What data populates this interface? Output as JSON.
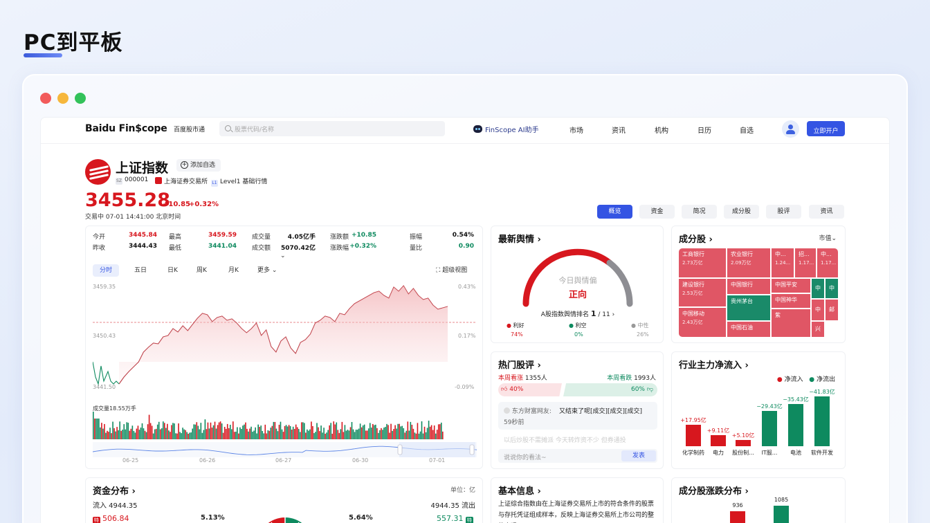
{
  "slide": {
    "title": "PC到平板"
  },
  "nav": {
    "logo": "Baidu Fin$cope",
    "sub": "百度股市通",
    "search_placeholder": "股票代码/名称",
    "ai": "FinScope AI助手",
    "items": [
      "市场",
      "资讯",
      "机构",
      "日历",
      "自选"
    ],
    "open_account": "立即开户"
  },
  "stock": {
    "name": "上证指数",
    "add_fav": "添加自选",
    "market_tag": "SZ",
    "code": "000001",
    "exchange": "上海证券交易所",
    "level_tag": "L1",
    "level": "Level1 基础行情",
    "price": "3455.28",
    "change": "+10.85",
    "change_pct": "+0.32%",
    "trade_time": "交易中  07-01 14:41:00 北京时间"
  },
  "tabs": [
    "概览",
    "资金",
    "简况",
    "成分股",
    "股评",
    "资讯"
  ],
  "quote": {
    "rows": [
      [
        {
          "k": "今开",
          "v": "3445.84",
          "c": "red"
        },
        {
          "k": "最高",
          "v": "3459.59",
          "c": "red"
        },
        {
          "k": "成交量",
          "v": "4.05亿手",
          "c": "dark"
        },
        {
          "k": "涨跌额",
          "v": "+10.85",
          "c": "green"
        },
        {
          "k": "振幅",
          "v": "0.54%",
          "c": "dark"
        }
      ],
      [
        {
          "k": "昨收",
          "v": "3444.43",
          "c": "dark"
        },
        {
          "k": "最低",
          "v": "3441.04",
          "c": "green"
        },
        {
          "k": "成交额",
          "v": "5070.42亿",
          "c": "dark"
        },
        {
          "k": "涨跌幅",
          "v": "+0.32%",
          "c": "green"
        },
        {
          "k": "量比",
          "v": "0.90",
          "c": "green"
        }
      ]
    ]
  },
  "period_tabs": [
    "分时",
    "五日",
    "日K",
    "周K",
    "月K",
    "更多"
  ],
  "super_view": "超级视图",
  "intraday": {
    "y_left": [
      "3459.35",
      "3450.43",
      "3441.50"
    ],
    "y_right": [
      "0.43%",
      "0.17%",
      "-0.09%"
    ],
    "volume_label": "成交量18.55万手",
    "x_labels": [
      "06-25",
      "06-26",
      "06-27",
      "06-30",
      "07-01"
    ]
  },
  "sentiment": {
    "title": "最新舆情",
    "gauge_label": "今日舆情偏",
    "gauge_value": "正向",
    "rank_label": "A股指数舆情排名",
    "rank": "1",
    "rank_total": "/ 11",
    "legend": [
      {
        "name": "利好",
        "pct": "74%",
        "color": "#d7171e"
      },
      {
        "name": "利空",
        "pct": "0%",
        "color": "#0e8a5f"
      },
      {
        "name": "中性",
        "pct": "26%",
        "color": "#999999"
      }
    ]
  },
  "hot": {
    "title": "热门股评",
    "bull_label": "本周看涨",
    "bull_count": "1355人",
    "bear_label": "本周看跌",
    "bear_count": "1993人",
    "bull_pct": "40%",
    "bear_pct": "60%",
    "comment_user": "东方财富网友:",
    "comment_text": "又结束了呢[成交][成交][成交]",
    "comment_time": "59秒前",
    "comment2": "以后炒股不需摊派  今天转炸资不少  但券通投",
    "input_placeholder": "说说你的看法~",
    "send": "发表"
  },
  "constituents": {
    "title": "成分股",
    "sort": "市值",
    "cells": [
      {
        "name": "工商银行",
        "cap": "2.73万亿",
        "c": "#e05665"
      },
      {
        "name": "农业银行",
        "cap": "2.09万亿",
        "c": "#e05665"
      },
      {
        "name": "中...",
        "cap": "1.24...",
        "c": "#e05665"
      },
      {
        "name": "招...",
        "cap": "1.17...",
        "c": "#e05665"
      },
      {
        "name": "中...",
        "cap": "1.17...",
        "c": "#e05665"
      },
      {
        "name": "建设银行",
        "cap": "2.53万亿",
        "c": "#e05665"
      },
      {
        "name": "中国银行",
        "cap": "",
        "c": "#e05665"
      },
      {
        "name": "中国平安",
        "cap": "",
        "c": "#e05665"
      },
      {
        "name": "中",
        "cap": "",
        "c": "#1a8a69"
      },
      {
        "name": "中",
        "cap": "",
        "c": "#1a8a69"
      },
      {
        "name": "贵州茅台",
        "cap": "",
        "c": "#1a8a69"
      },
      {
        "name": "中国神华",
        "cap": "",
        "c": "#e05665"
      },
      {
        "name": "中",
        "cap": "",
        "c": "#e05665"
      },
      {
        "name": "邮",
        "cap": "",
        "c": "#e05665"
      },
      {
        "name": "中国移动",
        "cap": "2.43万亿",
        "c": "#e05665"
      },
      {
        "name": "中国石油",
        "cap": "",
        "c": "#e05665"
      },
      {
        "name": "紫",
        "cap": "",
        "c": "#e05665"
      },
      {
        "name": "兴",
        "cap": "",
        "c": "#e05665"
      }
    ]
  },
  "industry": {
    "title": "行业主力净流入",
    "legend_in": "净流入",
    "legend_out": "净流出",
    "bars": [
      {
        "name": "化学制药",
        "value": "+17.95亿",
        "flow": 17.95
      },
      {
        "name": "电力",
        "value": "+9.11亿",
        "flow": 9.11
      },
      {
        "name": "股份制...",
        "value": "+5.10亿",
        "flow": 5.1
      },
      {
        "name": "IT服...",
        "value": "−29.43亿",
        "flow": -29.43
      },
      {
        "name": "电池",
        "value": "−35.43亿",
        "flow": -35.43
      },
      {
        "name": "软件开发",
        "value": "−41.83亿",
        "flow": -41.83
      }
    ]
  },
  "capital": {
    "title": "资金分布",
    "unit": "单位：亿",
    "inflow": "流入 4944.35",
    "outflow": "4944.35 流出",
    "tag_in": "特",
    "val_in": "506.84",
    "pct_in": "5.13%",
    "pct_out": "5.64%",
    "val_out": "557.31",
    "tag_out": "特"
  },
  "basic": {
    "title": "基本信息",
    "text": "上证综合指数由在上海证券交易所上市的符合条件的股票与存托凭证组成样本，反映上海证券交易所上市公司的整体表现。"
  },
  "dist": {
    "title": "成分股涨跌分布",
    "bars": [
      {
        "value": "936",
        "count": 936,
        "c": "#d7171e"
      },
      {
        "value": "1085",
        "count": 1085,
        "c": "#0e8a5f"
      }
    ]
  }
}
